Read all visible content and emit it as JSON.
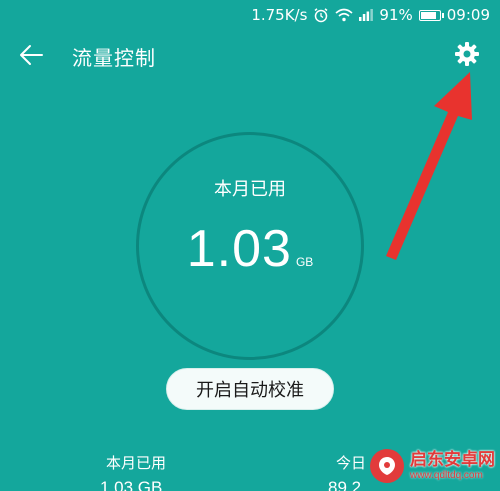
{
  "status_bar": {
    "network_speed": "1.75K/s",
    "battery_percent": "91%",
    "battery_level": 0.91,
    "time": "09:09",
    "icons": [
      "alarm-icon",
      "wifi-icon",
      "signal-icon",
      "battery-icon"
    ]
  },
  "header": {
    "title": "流量控制",
    "back_icon": "arrow-left-icon",
    "settings_icon": "gear-icon"
  },
  "usage_ring": {
    "label": "本月已用",
    "value": "1.03",
    "unit": "GB",
    "ring_color": "#0c877e"
  },
  "calibrate_button": {
    "label": "开启自动校准"
  },
  "stats": {
    "monthly_label": "本月已用",
    "monthly_value": "1.03 GB",
    "today_label": "今日",
    "today_value": "89.2"
  },
  "watermark": {
    "title": "启东安卓网",
    "url": "www.qdltdq.com"
  },
  "colors": {
    "background": "#14a79c",
    "arrow": "#e8332e",
    "button_bg": "#f4fbfa"
  }
}
